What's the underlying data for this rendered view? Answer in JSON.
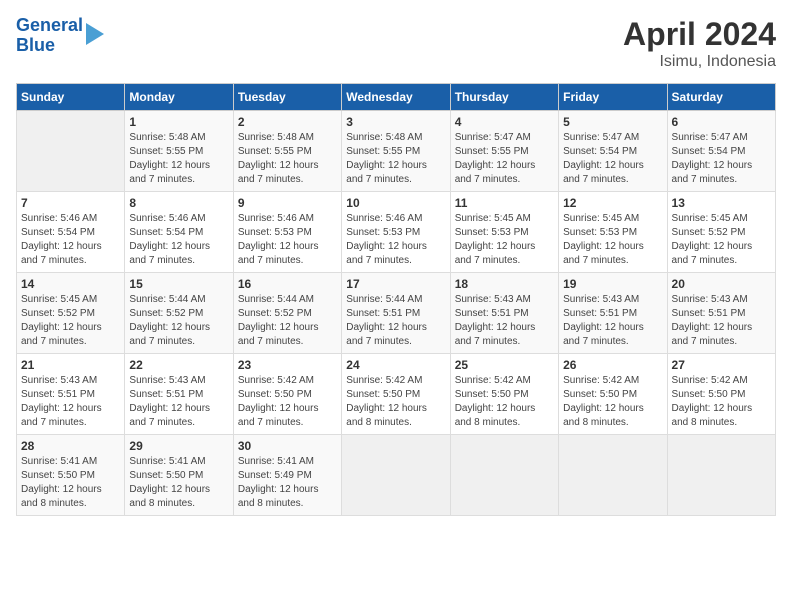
{
  "header": {
    "logo_line1": "General",
    "logo_line2": "Blue",
    "title": "April 2024",
    "subtitle": "Isimu, Indonesia"
  },
  "days_of_week": [
    "Sunday",
    "Monday",
    "Tuesday",
    "Wednesday",
    "Thursday",
    "Friday",
    "Saturday"
  ],
  "weeks": [
    [
      {
        "day": "",
        "info": ""
      },
      {
        "day": "1",
        "info": "Sunrise: 5:48 AM\nSunset: 5:55 PM\nDaylight: 12 hours\nand 7 minutes."
      },
      {
        "day": "2",
        "info": "Sunrise: 5:48 AM\nSunset: 5:55 PM\nDaylight: 12 hours\nand 7 minutes."
      },
      {
        "day": "3",
        "info": "Sunrise: 5:48 AM\nSunset: 5:55 PM\nDaylight: 12 hours\nand 7 minutes."
      },
      {
        "day": "4",
        "info": "Sunrise: 5:47 AM\nSunset: 5:55 PM\nDaylight: 12 hours\nand 7 minutes."
      },
      {
        "day": "5",
        "info": "Sunrise: 5:47 AM\nSunset: 5:54 PM\nDaylight: 12 hours\nand 7 minutes."
      },
      {
        "day": "6",
        "info": "Sunrise: 5:47 AM\nSunset: 5:54 PM\nDaylight: 12 hours\nand 7 minutes."
      }
    ],
    [
      {
        "day": "7",
        "info": "Sunrise: 5:46 AM\nSunset: 5:54 PM\nDaylight: 12 hours\nand 7 minutes."
      },
      {
        "day": "8",
        "info": "Sunrise: 5:46 AM\nSunset: 5:54 PM\nDaylight: 12 hours\nand 7 minutes."
      },
      {
        "day": "9",
        "info": "Sunrise: 5:46 AM\nSunset: 5:53 PM\nDaylight: 12 hours\nand 7 minutes."
      },
      {
        "day": "10",
        "info": "Sunrise: 5:46 AM\nSunset: 5:53 PM\nDaylight: 12 hours\nand 7 minutes."
      },
      {
        "day": "11",
        "info": "Sunrise: 5:45 AM\nSunset: 5:53 PM\nDaylight: 12 hours\nand 7 minutes."
      },
      {
        "day": "12",
        "info": "Sunrise: 5:45 AM\nSunset: 5:53 PM\nDaylight: 12 hours\nand 7 minutes."
      },
      {
        "day": "13",
        "info": "Sunrise: 5:45 AM\nSunset: 5:52 PM\nDaylight: 12 hours\nand 7 minutes."
      }
    ],
    [
      {
        "day": "14",
        "info": "Sunrise: 5:45 AM\nSunset: 5:52 PM\nDaylight: 12 hours\nand 7 minutes."
      },
      {
        "day": "15",
        "info": "Sunrise: 5:44 AM\nSunset: 5:52 PM\nDaylight: 12 hours\nand 7 minutes."
      },
      {
        "day": "16",
        "info": "Sunrise: 5:44 AM\nSunset: 5:52 PM\nDaylight: 12 hours\nand 7 minutes."
      },
      {
        "day": "17",
        "info": "Sunrise: 5:44 AM\nSunset: 5:51 PM\nDaylight: 12 hours\nand 7 minutes."
      },
      {
        "day": "18",
        "info": "Sunrise: 5:43 AM\nSunset: 5:51 PM\nDaylight: 12 hours\nand 7 minutes."
      },
      {
        "day": "19",
        "info": "Sunrise: 5:43 AM\nSunset: 5:51 PM\nDaylight: 12 hours\nand 7 minutes."
      },
      {
        "day": "20",
        "info": "Sunrise: 5:43 AM\nSunset: 5:51 PM\nDaylight: 12 hours\nand 7 minutes."
      }
    ],
    [
      {
        "day": "21",
        "info": "Sunrise: 5:43 AM\nSunset: 5:51 PM\nDaylight: 12 hours\nand 7 minutes."
      },
      {
        "day": "22",
        "info": "Sunrise: 5:43 AM\nSunset: 5:51 PM\nDaylight: 12 hours\nand 7 minutes."
      },
      {
        "day": "23",
        "info": "Sunrise: 5:42 AM\nSunset: 5:50 PM\nDaylight: 12 hours\nand 7 minutes."
      },
      {
        "day": "24",
        "info": "Sunrise: 5:42 AM\nSunset: 5:50 PM\nDaylight: 12 hours\nand 8 minutes."
      },
      {
        "day": "25",
        "info": "Sunrise: 5:42 AM\nSunset: 5:50 PM\nDaylight: 12 hours\nand 8 minutes."
      },
      {
        "day": "26",
        "info": "Sunrise: 5:42 AM\nSunset: 5:50 PM\nDaylight: 12 hours\nand 8 minutes."
      },
      {
        "day": "27",
        "info": "Sunrise: 5:42 AM\nSunset: 5:50 PM\nDaylight: 12 hours\nand 8 minutes."
      }
    ],
    [
      {
        "day": "28",
        "info": "Sunrise: 5:41 AM\nSunset: 5:50 PM\nDaylight: 12 hours\nand 8 minutes."
      },
      {
        "day": "29",
        "info": "Sunrise: 5:41 AM\nSunset: 5:50 PM\nDaylight: 12 hours\nand 8 minutes."
      },
      {
        "day": "30",
        "info": "Sunrise: 5:41 AM\nSunset: 5:49 PM\nDaylight: 12 hours\nand 8 minutes."
      },
      {
        "day": "",
        "info": ""
      },
      {
        "day": "",
        "info": ""
      },
      {
        "day": "",
        "info": ""
      },
      {
        "day": "",
        "info": ""
      }
    ]
  ]
}
